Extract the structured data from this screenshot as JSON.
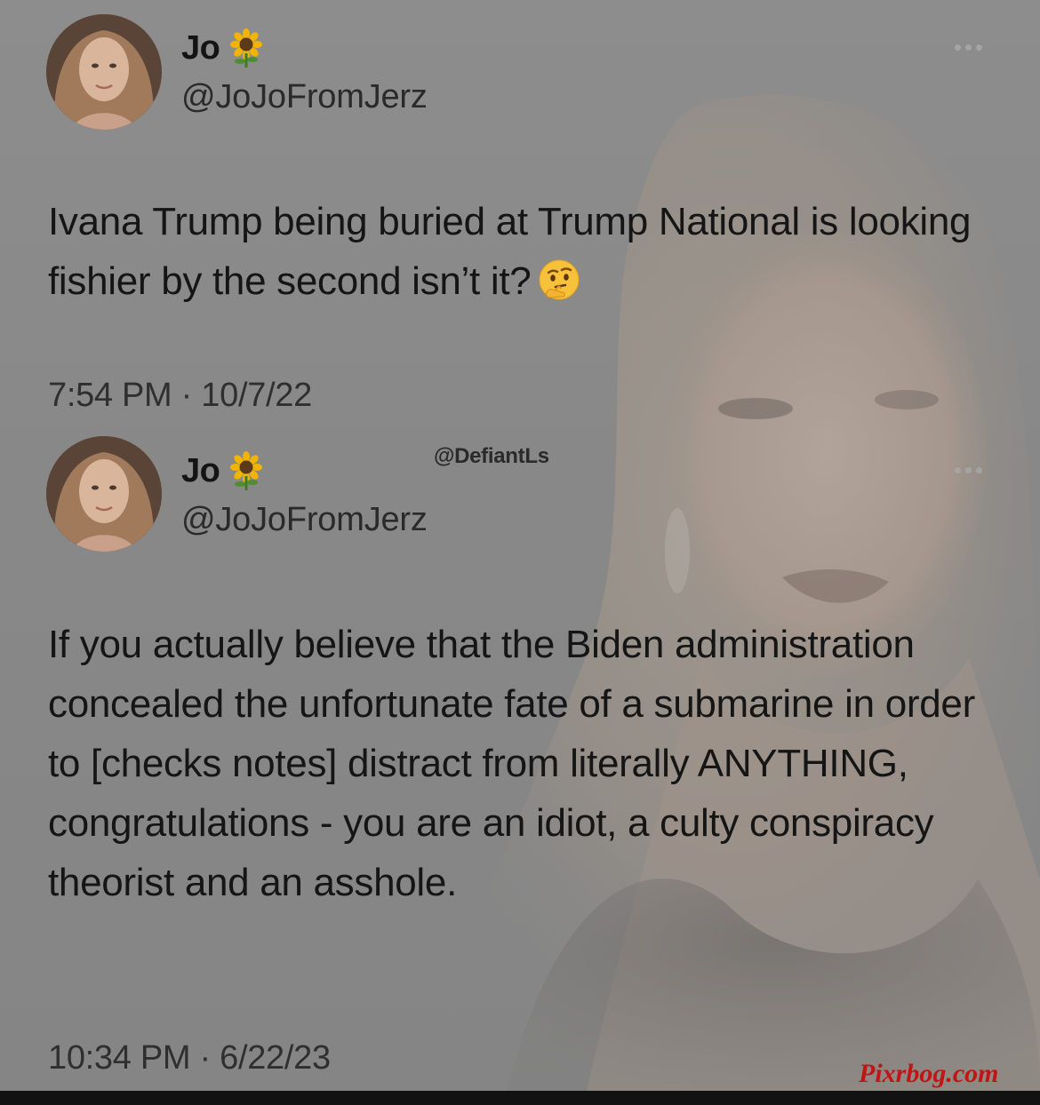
{
  "tweets": [
    {
      "name": "Jo",
      "name_emoji": "sunflower-icon",
      "handle": "@JoJoFromJerz",
      "text": "Ivana Trump being buried at Trump National is looking fishier by the second isn’t it?",
      "text_emoji": "thinking-face-icon",
      "timestamp": "7:54 PM · 10/7/22"
    },
    {
      "name": "Jo",
      "name_emoji": "sunflower-icon",
      "handle": "@JoJoFromJerz",
      "text": "If you actually believe that the Biden administration concealed the unfortunate fate of a submarine in order to [checks notes] distract from literally ANYTHING, congratulations - you are an idiot, a culty conspiracy theorist and an asshole.",
      "timestamp": "10:34 PM · 6/22/23"
    }
  ],
  "watermarks": {
    "defiant": "@DefiantLs",
    "pixrbog": "Pixrbog.com"
  },
  "colors": {
    "background": "#8a8a8a",
    "text": "#151515",
    "watermark_red": "#c11414"
  }
}
